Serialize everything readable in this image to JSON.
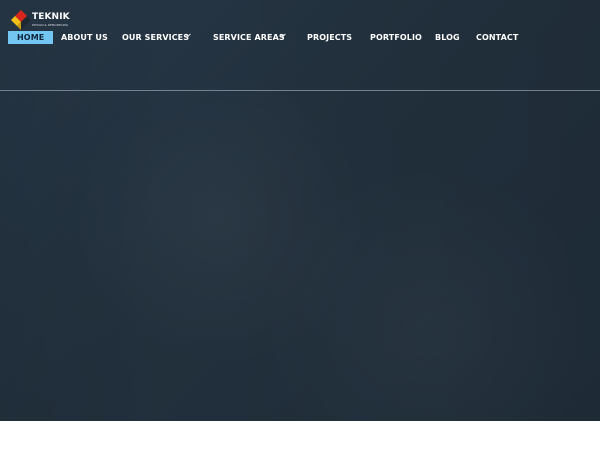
{
  "brand": {
    "name": "TEKNIK",
    "tagline": "DESIGN & REMODELING",
    "colors": {
      "red": "#d7261b",
      "yellow": "#f2c21b",
      "dark": "#2d3944"
    }
  },
  "nav": {
    "items": [
      {
        "label": "HOME",
        "active": true
      },
      {
        "label": "ABOUT US"
      },
      {
        "label": "OUR SERVICES",
        "has_dropdown": true
      },
      {
        "label": "SERVICE AREAS",
        "has_dropdown": true
      },
      {
        "label": "PROJECTS"
      },
      {
        "label": "PORTFOLIO"
      },
      {
        "label": "BLOG"
      },
      {
        "label": "CONTACT"
      }
    ]
  },
  "theme": {
    "hero_background": "#22303d",
    "active_nav_background": "#73c6f2",
    "active_nav_text": "#10253a",
    "nav_text": "#ffffff"
  },
  "icons": {
    "logo": "teknik-diamond-logo-icon",
    "dropdown": "chevron-down-icon"
  }
}
